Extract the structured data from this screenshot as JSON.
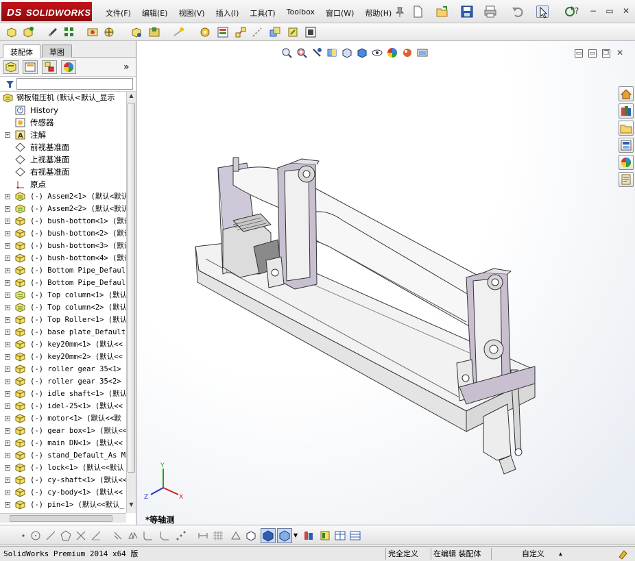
{
  "app": {
    "brand": "SOLIDWORKS",
    "brand_prefix": "DS"
  },
  "menu": [
    {
      "label": "文件(F)"
    },
    {
      "label": "编辑(E)"
    },
    {
      "label": "视图(V)"
    },
    {
      "label": "插入(I)"
    },
    {
      "label": "工具(T)"
    },
    {
      "label": "Toolbox"
    },
    {
      "label": "窗口(W)"
    },
    {
      "label": "帮助(H)"
    }
  ],
  "window_controls": {
    "help": "?",
    "minimize": "−",
    "restore": "▭",
    "close": "✕"
  },
  "panel": {
    "tabs": [
      {
        "label": "装配体"
      },
      {
        "label": "草图"
      }
    ],
    "expand_glyph": "»"
  },
  "tree": {
    "root": "钢板辊压机  (默认<默认_显示",
    "features": [
      {
        "label": "History",
        "icon": "history-icon",
        "expandable": false
      },
      {
        "label": "传感器",
        "icon": "sensor-icon",
        "expandable": false
      },
      {
        "label": "注解",
        "icon": "annotation-icon",
        "expandable": true
      },
      {
        "label": "前视基准面",
        "icon": "plane-icon",
        "expandable": false
      },
      {
        "label": "上视基准面",
        "icon": "plane-icon",
        "expandable": false
      },
      {
        "label": "右视基准面",
        "icon": "plane-icon",
        "expandable": false
      },
      {
        "label": "原点",
        "icon": "origin-icon",
        "expandable": false
      }
    ],
    "components": [
      {
        "label": "(-) Assem2<1> (默认<默认",
        "icon": "subassembly-icon"
      },
      {
        "label": "(-) Assem2<2> (默认<默认",
        "icon": "subassembly-icon"
      },
      {
        "label": "(-) bush-bottom<1> (默认",
        "icon": "part-icon"
      },
      {
        "label": "(-) bush-bottom<2> (默认",
        "icon": "part-icon"
      },
      {
        "label": "(-) bush-bottom<3> (默认",
        "icon": "part-icon"
      },
      {
        "label": "(-) bush-bottom<4> (默认",
        "icon": "part-icon"
      },
      {
        "label": "(-) Bottom Pipe_Default",
        "icon": "part-icon"
      },
      {
        "label": "(-) Bottom Pipe_Default",
        "icon": "part-icon"
      },
      {
        "label": "(-) Top column<1> (默认",
        "icon": "subassembly-icon"
      },
      {
        "label": "(-) Top column<2> (默认",
        "icon": "subassembly-icon"
      },
      {
        "label": "(-) Top Roller<1> (默认",
        "icon": "part-icon"
      },
      {
        "label": "(-) base plate_Default_",
        "icon": "part-icon"
      },
      {
        "label": "(-) key20mm<1> (默认<<",
        "icon": "part-icon"
      },
      {
        "label": "(-) key20mm<2> (默认<<",
        "icon": "part-icon"
      },
      {
        "label": "(-) roller gear 35<1> (",
        "icon": "part-icon"
      },
      {
        "label": "(-) roller gear 35<2> (",
        "icon": "part-icon"
      },
      {
        "label": "(-) idle shaft<1> (默认",
        "icon": "part-icon"
      },
      {
        "label": "(-) idel-25<1> (默认<<",
        "icon": "part-icon"
      },
      {
        "label": "(-) motor<1> (默认<<默",
        "icon": "part-icon"
      },
      {
        "label": "(-) gear box<1> (默认<<",
        "icon": "part-icon"
      },
      {
        "label": "(-) main DN<1> (默认<<",
        "icon": "part-icon"
      },
      {
        "label": "(-) stand_Default_As Ma",
        "icon": "part-icon"
      },
      {
        "label": "(-) lock<1> (默认<<默认",
        "icon": "part-icon"
      },
      {
        "label": "(-) cy-shaft<1> (默认<<",
        "icon": "part-icon"
      },
      {
        "label": "(-) cy-body<1> (默认<<",
        "icon": "part-icon"
      },
      {
        "label": "(-) pin<1> (默认<<默认_",
        "icon": "part-icon"
      }
    ]
  },
  "viewport": {
    "view_label": "*等轴测",
    "triad": {
      "x": "X",
      "y": "Y",
      "z": "Z"
    },
    "colors": {
      "frame": "#f2f2f2",
      "roller": "#f4f4f4",
      "column": "#c8c0d0",
      "edge": "#333333"
    }
  },
  "statusbar": {
    "product": "SolidWorks Premium 2014 x64 版",
    "definition": "完全定义",
    "mode": "在编辑 装配体",
    "units": "自定义",
    "units_arrow": "▲"
  }
}
